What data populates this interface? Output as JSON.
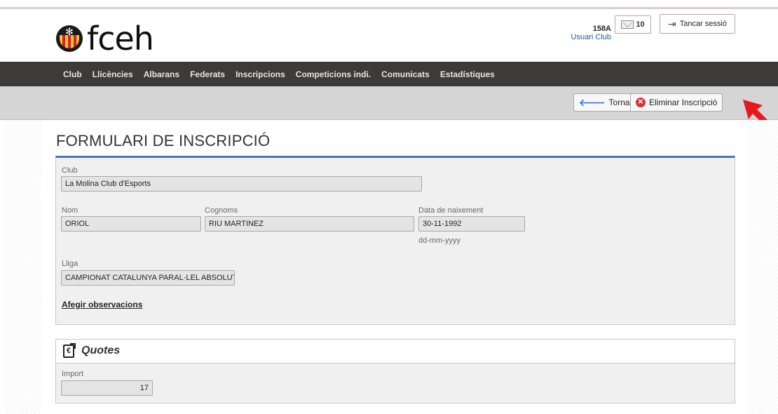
{
  "header": {
    "logo_text": "fceh",
    "user_code": "158A",
    "user_role": "Usuari Club",
    "messages_count": "10",
    "logout_label": "Tancar sessió"
  },
  "nav": {
    "items": [
      "Club",
      "Llicències",
      "Albarans",
      "Federats",
      "Inscripcions",
      "Competicions indi.",
      "Comunicats",
      "Estadístiques"
    ]
  },
  "toolbar": {
    "back_label": "Tornar",
    "delete_label": "Eliminar Inscripció"
  },
  "form": {
    "title": "FORMULARI DE INSCRIPCIÓ",
    "club_label": "Club",
    "club_value": "La Molina Club d'Esports",
    "nom_label": "Nom",
    "nom_value": "ORIOL",
    "cognoms_label": "Cognoms",
    "cognoms_value": "RIU MARTINEZ",
    "data_label": "Data de naixement",
    "data_value": "30-11-1992",
    "data_hint": "dd-mm-yyyy",
    "lliga_label": "Lliga",
    "lliga_value": "CAMPIONAT CATALUNYA PARAL·LEL ABSOLUT",
    "observ_link": "Afegir observacions"
  },
  "quotes": {
    "title": "Quotes",
    "import_label": "Import",
    "import_value": "17"
  },
  "colors": {
    "nav_bg": "#3c3b38",
    "panel_accent": "#4a72b9",
    "delete_red": "#d7343a",
    "back_blue": "#3877d9",
    "annotation_arrow": "#e8161d"
  },
  "icons": {
    "logo": "snowflake-seal-icon",
    "messages": "envelope-icon",
    "logout": "logout-icon",
    "back": "arrow-left-icon",
    "delete": "x-circle-icon",
    "quotes": "euro-document-icon"
  }
}
